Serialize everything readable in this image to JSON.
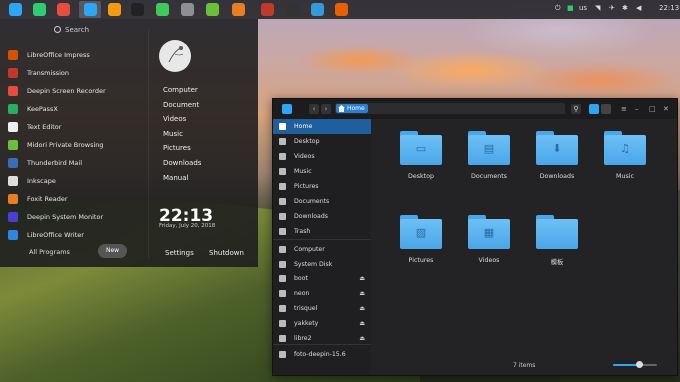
{
  "dock": {
    "apps": [
      {
        "name": "launcher-icon",
        "color": "#2ca7f8"
      },
      {
        "name": "multitask-icon",
        "color": "#2ecc71"
      },
      {
        "name": "screenshot-icon",
        "color": "#e74c3c"
      },
      {
        "name": "file-manager-dock-icon",
        "color": "#2ca7f8"
      },
      {
        "name": "archive-icon",
        "color": "#f39c12"
      },
      {
        "name": "terminal-icon",
        "color": "#222222"
      },
      {
        "name": "system-monitor-icon",
        "color": "#3ec95a"
      },
      {
        "name": "settings-gear-icon",
        "color": "#8e8e93"
      },
      {
        "name": "midori-icon",
        "color": "#6abf3b"
      },
      {
        "name": "document-viewer-icon",
        "color": "#e67e22"
      },
      {
        "name": "app-store-icon",
        "color": "#c0392b"
      },
      {
        "name": "remote-icon",
        "color": "#333333"
      },
      {
        "name": "vm-icon",
        "color": "#3498db"
      },
      {
        "name": "firefox-icon",
        "color": "#e66000"
      }
    ],
    "tray": {
      "keyboard_layout": "us",
      "time": "22:13"
    }
  },
  "launcher": {
    "search_placeholder": "Search",
    "apps": [
      {
        "label": "LibreOffice Impress",
        "color": "#d35400"
      },
      {
        "label": "Transmission",
        "color": "#c0392b"
      },
      {
        "label": "Deepin Screen Recorder",
        "color": "#e74c3c"
      },
      {
        "label": "KeePassX",
        "color": "#27ae60"
      },
      {
        "label": "Text Editor",
        "color": "#ecf0f1"
      },
      {
        "label": "Midori Private Browsing",
        "color": "#6abf3b"
      },
      {
        "label": "Thunderbird Mail",
        "color": "#3a6db5"
      },
      {
        "label": "Inkscape",
        "color": "#dddddd"
      },
      {
        "label": "Foxit Reader",
        "color": "#e67e22"
      },
      {
        "label": "Deepin System Monitor",
        "color": "#4a3fd1"
      },
      {
        "label": "LibreOffice Writer",
        "color": "#2e86de"
      }
    ],
    "all_programs": "All Programs",
    "new_button": "New",
    "places": [
      "Computer",
      "Document",
      "Videos",
      "Music",
      "Pictures",
      "Downloads",
      "Manual"
    ],
    "clock": "22:13",
    "date": "Friday, July 20, 2018",
    "settings_label": "Settings",
    "shutdown_label": "Shutdown"
  },
  "file_manager": {
    "breadcrumb": "Home",
    "sidebar": [
      {
        "label": "Home",
        "selected": true
      },
      {
        "label": "Desktop"
      },
      {
        "label": "Videos"
      },
      {
        "label": "Music"
      },
      {
        "label": "Pictures"
      },
      {
        "label": "Documents"
      },
      {
        "label": "Downloads"
      },
      {
        "label": "Trash"
      },
      {
        "label": "Computer"
      },
      {
        "label": "System Disk"
      },
      {
        "label": "boot",
        "eject": true
      },
      {
        "label": "neon",
        "eject": true
      },
      {
        "label": "trisquel",
        "eject": true
      },
      {
        "label": "yakkety",
        "eject": true
      },
      {
        "label": "libre2",
        "eject": true
      },
      {
        "label": "foto-deepin-15.6"
      }
    ],
    "folders": [
      {
        "label": "Desktop",
        "glyph": "▭"
      },
      {
        "label": "Documents",
        "glyph": "▤"
      },
      {
        "label": "Downloads",
        "glyph": "⬇"
      },
      {
        "label": "Music",
        "glyph": "♫"
      },
      {
        "label": "Pictures",
        "glyph": "▨"
      },
      {
        "label": "Videos",
        "glyph": "▦"
      },
      {
        "label": "模板",
        "glyph": ""
      }
    ],
    "status": "7 items",
    "zoom_level": 0.6,
    "accent": "#2ca7f8"
  }
}
